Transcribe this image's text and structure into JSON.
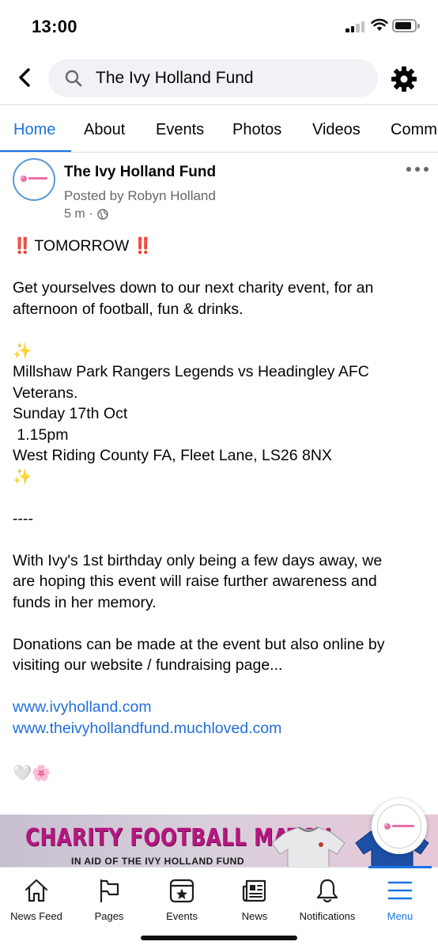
{
  "status_bar": {
    "time": "13:00"
  },
  "header": {
    "search_value": "The Ivy Holland Fund",
    "icons": [
      "back-chevron-icon",
      "search-icon",
      "gear-icon"
    ]
  },
  "tabs": [
    {
      "label": "Home",
      "active": true
    },
    {
      "label": "About"
    },
    {
      "label": "Events"
    },
    {
      "label": "Photos"
    },
    {
      "label": "Videos"
    },
    {
      "label": "Comm"
    }
  ],
  "post": {
    "page_name": "The Ivy Holland Fund",
    "posted_by": "Posted by Robyn Holland",
    "time": "5 m",
    "separator": "·",
    "lines": {
      "bang": "‼️",
      "headline": "TOMORROW",
      "intro_1": "Get yourselves down to our next charity event, for an",
      "intro_2": "afternoon of football, fun & drinks.",
      "sparkle": "✨",
      "match_1": "Millshaw Park Rangers Legends vs Headingley AFC",
      "match_2": "Veterans.",
      "date": "Sunday 17th Oct",
      "time": " 1.15pm",
      "venue": "West Riding County FA, Fleet Lane, LS26 8NX",
      "divider": "----",
      "memory_1": "With Ivy's 1st birthday only being a few days away, we",
      "memory_2": "are hoping this event will raise further awareness and",
      "memory_3": "funds in her memory.",
      "donate_1": "Donations can be made at the event but also online by",
      "donate_2": "visiting our website / fundraising page...",
      "link_1": "www.ivyholland.com",
      "link_2": "www.theivyhollandfund.muchloved.com",
      "emoji_end": "🤍🌸"
    }
  },
  "banner": {
    "title": "CHARITY FOOTBALL MATCH",
    "subtitle": "IN AID OF THE IVY HOLLAND FUND"
  },
  "bottom_nav": [
    {
      "label": "News Feed",
      "icon": "home-icon"
    },
    {
      "label": "Pages",
      "icon": "flag-icon"
    },
    {
      "label": "Events",
      "icon": "calendar-star-icon"
    },
    {
      "label": "News",
      "icon": "newspaper-icon"
    },
    {
      "label": "Notifications",
      "icon": "bell-icon"
    },
    {
      "label": "Menu",
      "icon": "menu-icon",
      "active": true
    }
  ],
  "colors": {
    "accent": "#1b74e4",
    "link": "#216fdb",
    "secondary_text": "#65676b"
  }
}
